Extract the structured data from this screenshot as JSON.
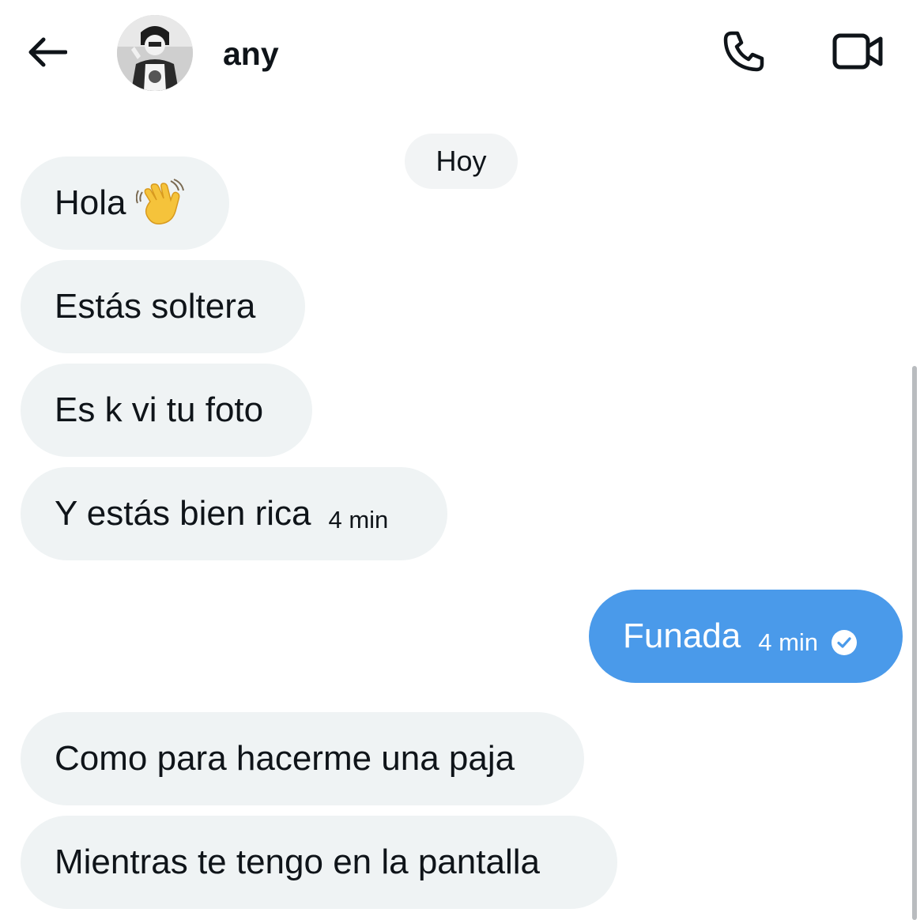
{
  "header": {
    "back_icon": "arrow-left-icon",
    "contact_name": "any",
    "call_icon": "phone-icon",
    "video_icon": "video-camera-icon"
  },
  "date_separator": "Hoy",
  "messages": [
    {
      "direction": "incoming",
      "text": "Hola",
      "emoji": "waving-hand-icon"
    },
    {
      "direction": "incoming",
      "text": "Estás soltera"
    },
    {
      "direction": "incoming",
      "text": "Es k vi tu foto"
    },
    {
      "direction": "incoming",
      "text": "Y estás bien rica",
      "time": "4 min"
    },
    {
      "direction": "outgoing",
      "text": "Funada",
      "time": "4 min",
      "status_icon": "check-circle-icon"
    },
    {
      "direction": "incoming",
      "text": "Como para hacerme una paja"
    },
    {
      "direction": "incoming",
      "text": "Mientras te tengo en la pantalla"
    }
  ],
  "colors": {
    "incoming_bubble": "#eff3f4",
    "outgoing_bubble": "#4a9aea",
    "text": "#0f1419"
  }
}
